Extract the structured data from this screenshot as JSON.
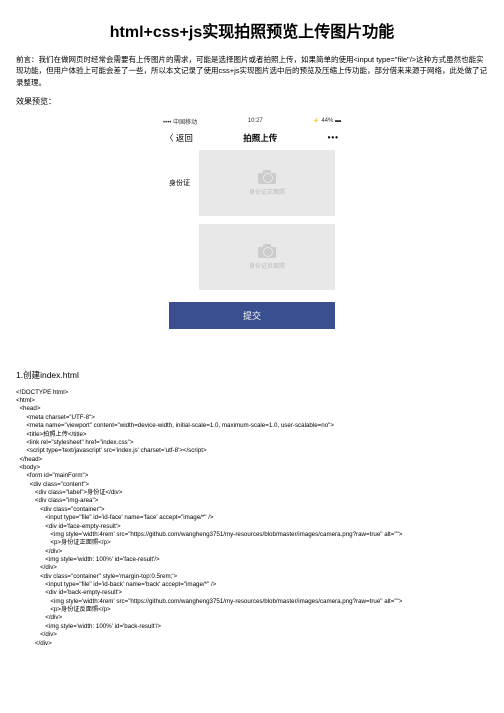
{
  "title": "html+css+js实现拍照预览上传图片功能",
  "intro": "前言：我们在做网页时经常会需要有上传图片的需求，可能是选择图片或者拍照上传，如果简单的使用<input type=\"file\"/>这种方式虽然也能实现功能，但用户体验上可能会差了一些，所以本文记录了使用css+js实现图片选中后的预览及压缩上传功能，部分借来来源于网络，此处做了记录整理。",
  "previewLabel": "效果预览：",
  "phone": {
    "carrier": "•••• 中国移动",
    "time": "10:27",
    "battery": "44%",
    "back": "〈 返回",
    "navTitle": "拍照上传",
    "more": "•••",
    "idLabel": "身份证",
    "ph1": "身份证正面照",
    "ph2": "身份证反面照",
    "submit": "提交"
  },
  "step1": "1.创建index.html",
  "code": "<!DOCTYPE html>\n<html>\n  <head>\n      <meta charset=\"UTF-8\">\n      <meta name=\"viewport\" content=\"width=device-width, initial-scale=1.0, maximum-scale=1.0, user-scalable=no\">\n      <title>拍照上传</title>\n      <link rel=\"stylesheet\" href=\"index.css\">\n      <script type='text/javascript' src='index.js' charset='utf-8'></script>\n  </head>\n  <body>\n      <form id=\"mainForm\">\n        <div class=\"content\">\n           <div class=\"label\">身份证</div>\n           <div class=\"img-area\">\n              <div class=\"container\">\n                 <input type=\"file\" id='id-face' name='face' accept=\"image/*\" />\n                 <div id='face-empty-result'>\n                    <img style='width:4rem' src=\"https://github.com/wangheng3751/my-resources/blob/master/images/camera.png?raw=true\" alt=\"\">\n                    <p>身份证正面照</p>\n                 </div>\n                 <img style='width: 100%' id='face-result'/>\n              </div>\n              <div class=\"container\" style='margin-top:0.5rem;'>\n                 <input type=\"file\" id='id-back' name='back' accept=\"image/*\" />\n                 <div id='back-empty-result'>\n                    <img style='width:4rem' src=\"https://github.com/wangheng3751/my-resources/blob/master/images/camera.png?raw=true\" alt=\"\">\n                    <p>身份证反面照</p>\n                 </div>\n                 <img style='width: 100%' id='back-result'/>\n              </div>\n           </div>"
}
